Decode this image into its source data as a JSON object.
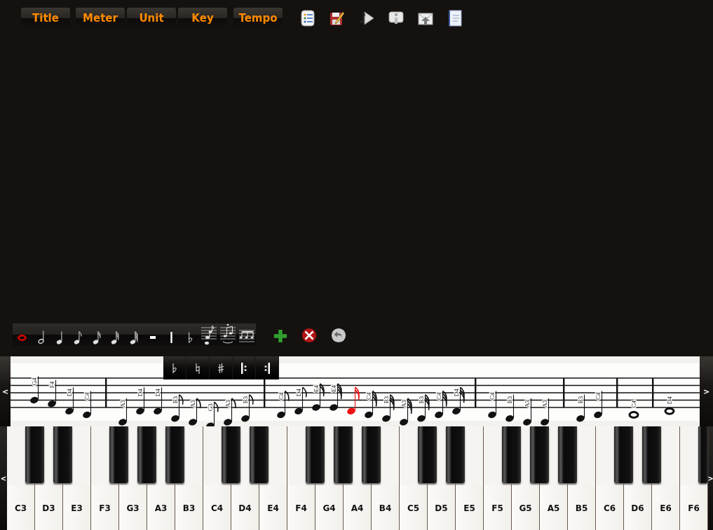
{
  "menu_buttons": [
    {
      "label": "Title"
    },
    {
      "label": "Meter"
    },
    {
      "label": "Unit"
    },
    {
      "label": "Key"
    },
    {
      "label": "Tempo"
    }
  ],
  "note_toolbar": [
    {
      "kind": "whole",
      "selected": true
    },
    {
      "kind": "half",
      "selected": false
    },
    {
      "kind": "quarter",
      "selected": false
    },
    {
      "kind": "eighth",
      "selected": false
    },
    {
      "kind": "sixteenth",
      "selected": false
    },
    {
      "kind": "thirtysecond",
      "selected": false
    },
    {
      "kind": "sixtyfourth",
      "selected": false
    },
    {
      "kind": "rest",
      "selected": false
    },
    {
      "kind": "bar",
      "selected": false
    },
    {
      "kind": "flat",
      "selected": false
    },
    {
      "kind": "grace",
      "selected": false
    },
    {
      "kind": "chord",
      "selected": false
    },
    {
      "kind": "beam",
      "selected": false
    }
  ],
  "accidentals": [
    {
      "kind": "flat"
    },
    {
      "kind": "natural"
    },
    {
      "kind": "sharp"
    },
    {
      "kind": "repeat_start"
    },
    {
      "kind": "repeat_end"
    }
  ],
  "staff": {
    "scroll_left": "<",
    "scroll_right": ">",
    "measures": [
      {
        "notes": [
          {
            "label": "G4",
            "kind": "quarter",
            "selected": false
          },
          {
            "label": "F4",
            "kind": "quarter",
            "selected": false
          },
          {
            "label": "D4",
            "kind": "quarter",
            "selected": false
          },
          {
            "label": "C4",
            "kind": "quarter",
            "selected": false
          }
        ]
      },
      {
        "notes": [
          {
            "label": "A3",
            "kind": "quarter",
            "selected": false
          },
          {
            "label": "D4",
            "kind": "quarter",
            "selected": false
          },
          {
            "label": "D4",
            "kind": "quarter",
            "selected": false
          },
          {
            "label": "B3",
            "kind": "eighth",
            "selected": false
          },
          {
            "label": "A3",
            "kind": "eighth",
            "selected": false
          },
          {
            "label": "G3",
            "kind": "eighth",
            "selected": false
          },
          {
            "label": "A3",
            "kind": "eighth",
            "selected": false
          },
          {
            "label": "B3",
            "kind": "eighth",
            "selected": false
          }
        ]
      },
      {
        "notes": [
          {
            "label": "C4",
            "kind": "eighth",
            "selected": false
          },
          {
            "label": "D4",
            "kind": "eighth",
            "selected": false
          },
          {
            "label": "E4",
            "kind": "sixteenth",
            "selected": false
          },
          {
            "label": "E4",
            "kind": "thirtysecond",
            "selected": false
          },
          {
            "kind": "sixteenth",
            "selected": true
          },
          {
            "label": "C4",
            "kind": "thirtysecond",
            "selected": false
          },
          {
            "label": "B3",
            "kind": "thirtysecond",
            "selected": false
          },
          {
            "label": "A3",
            "kind": "thirtysecond",
            "selected": false
          },
          {
            "label": "B3",
            "kind": "thirtysecond",
            "selected": false
          },
          {
            "label": "C4",
            "kind": "thirtysecond",
            "selected": false
          },
          {
            "label": "D4",
            "kind": "thirtysecond",
            "selected": false
          }
        ]
      },
      {
        "notes": [
          {
            "label": "C4",
            "kind": "quarter",
            "selected": false
          },
          {
            "label": "B3",
            "kind": "quarter",
            "selected": false
          },
          {
            "label": "A3",
            "kind": "quarter",
            "selected": false
          },
          {
            "label": "A3",
            "kind": "quarter",
            "selected": false
          }
        ]
      },
      {
        "notes": [
          {
            "label": "B3",
            "kind": "quarter",
            "selected": false
          },
          {
            "label": "C4",
            "kind": "quarter",
            "selected": false
          }
        ]
      },
      {
        "notes": [
          {
            "label": "C4",
            "kind": "whole",
            "selected": false
          }
        ]
      },
      {
        "notes": [
          {
            "label": "D4",
            "kind": "whole",
            "selected": false
          }
        ]
      }
    ]
  },
  "keyboard": {
    "scroll_left": "<",
    "scroll_right": ">",
    "keys": [
      {
        "label": "C3",
        "black_key": true
      },
      {
        "label": "D3",
        "black_key": true
      },
      {
        "label": "E3",
        "black_key": false
      },
      {
        "label": "F3",
        "black_key": true
      },
      {
        "label": "G3",
        "black_key": true
      },
      {
        "label": "A3",
        "black_key": true
      },
      {
        "label": "B3",
        "black_key": false
      },
      {
        "label": "C4",
        "black_key": true
      },
      {
        "label": "D4",
        "black_key": true
      },
      {
        "label": "E4",
        "black_key": false
      },
      {
        "label": "F4",
        "black_key": true
      },
      {
        "label": "G4",
        "black_key": true
      },
      {
        "label": "A4",
        "black_key": true
      },
      {
        "label": "B4",
        "black_key": false
      },
      {
        "label": "C5",
        "black_key": true
      },
      {
        "label": "D5",
        "black_key": true
      },
      {
        "label": "E5",
        "black_key": false
      },
      {
        "label": "F5",
        "black_key": true
      },
      {
        "label": "G5",
        "black_key": true
      },
      {
        "label": "A5",
        "black_key": true
      },
      {
        "label": "B5",
        "black_key": false
      },
      {
        "label": "C6",
        "black_key": true
      },
      {
        "label": "D6",
        "black_key": true
      },
      {
        "label": "E6",
        "black_key": false
      },
      {
        "label": "F6",
        "black_key": true
      }
    ]
  }
}
